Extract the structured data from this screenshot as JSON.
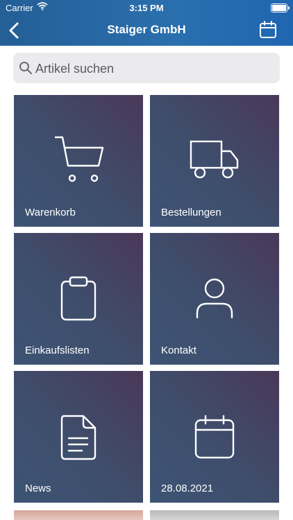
{
  "status_bar": {
    "carrier": "Carrier",
    "time": "3:15 PM"
  },
  "nav": {
    "title": "Staiger GmbH",
    "back_icon": "chevron-left-icon",
    "calendar_icon": "calendar-icon"
  },
  "search": {
    "placeholder": "Artikel suchen",
    "value": ""
  },
  "tiles": [
    {
      "label": "Warenkorb",
      "icon": "cart-icon"
    },
    {
      "label": "Bestellungen",
      "icon": "truck-icon"
    },
    {
      "label": "Einkaufslisten",
      "icon": "clipboard-icon"
    },
    {
      "label": "Kontakt",
      "icon": "person-icon"
    },
    {
      "label": "News",
      "icon": "document-icon"
    },
    {
      "label": "28.08.2021",
      "icon": "calendar-icon"
    }
  ],
  "colors": {
    "header": "#2a6fae",
    "tile_start": "#3d5474",
    "tile_end": "#4a3859",
    "peek_left": "#d7a59b",
    "peek_right": "#b9b9b9"
  }
}
